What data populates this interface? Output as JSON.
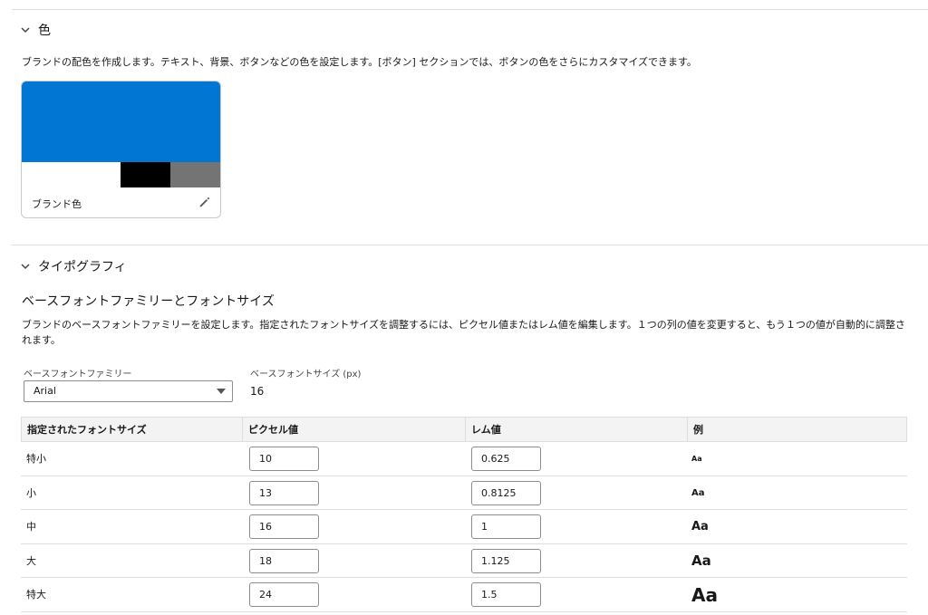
{
  "color_section": {
    "title": "色",
    "description": "ブランドの配色を作成します。テキスト、背景、ボタンなどの色を設定します。[ボタン] セクションでは、ボタンの色をさらにカスタマイズできます。",
    "brand_card": {
      "label": "ブランド色",
      "primary": "#0176D3",
      "swatches": [
        "#FFFFFF",
        "#000000",
        "#747474"
      ]
    }
  },
  "typography_section": {
    "title": "タイポグラフィ",
    "subheading": "ベースフォントファミリーとフォントサイズ",
    "description": "ブランドのベースフォントファミリーを設定します。指定されたフォントサイズを調整するには、ピクセル値またはレム値を編集します。１つの列の値を変更すると、もう１つの値が自動的に調整されます。",
    "family_label": "ベースフォントファミリー",
    "family_value": "Arial",
    "size_label": "ベースフォントサイズ (px)",
    "size_value": "16",
    "table": {
      "headers": [
        "指定されたフォントサイズ",
        "ピクセル値",
        "レム値",
        "例"
      ],
      "rows": [
        {
          "name": "特小",
          "px": "10",
          "rem": "0.625",
          "sample": "Aa"
        },
        {
          "name": "小",
          "px": "13",
          "rem": "0.8125",
          "sample": "Aa"
        },
        {
          "name": "中",
          "px": "16",
          "rem": "1",
          "sample": "Aa"
        },
        {
          "name": "大",
          "px": "18",
          "rem": "1.125",
          "sample": "Aa"
        },
        {
          "name": "特大",
          "px": "24",
          "rem": "1.5",
          "sample": "Aa"
        }
      ]
    }
  }
}
